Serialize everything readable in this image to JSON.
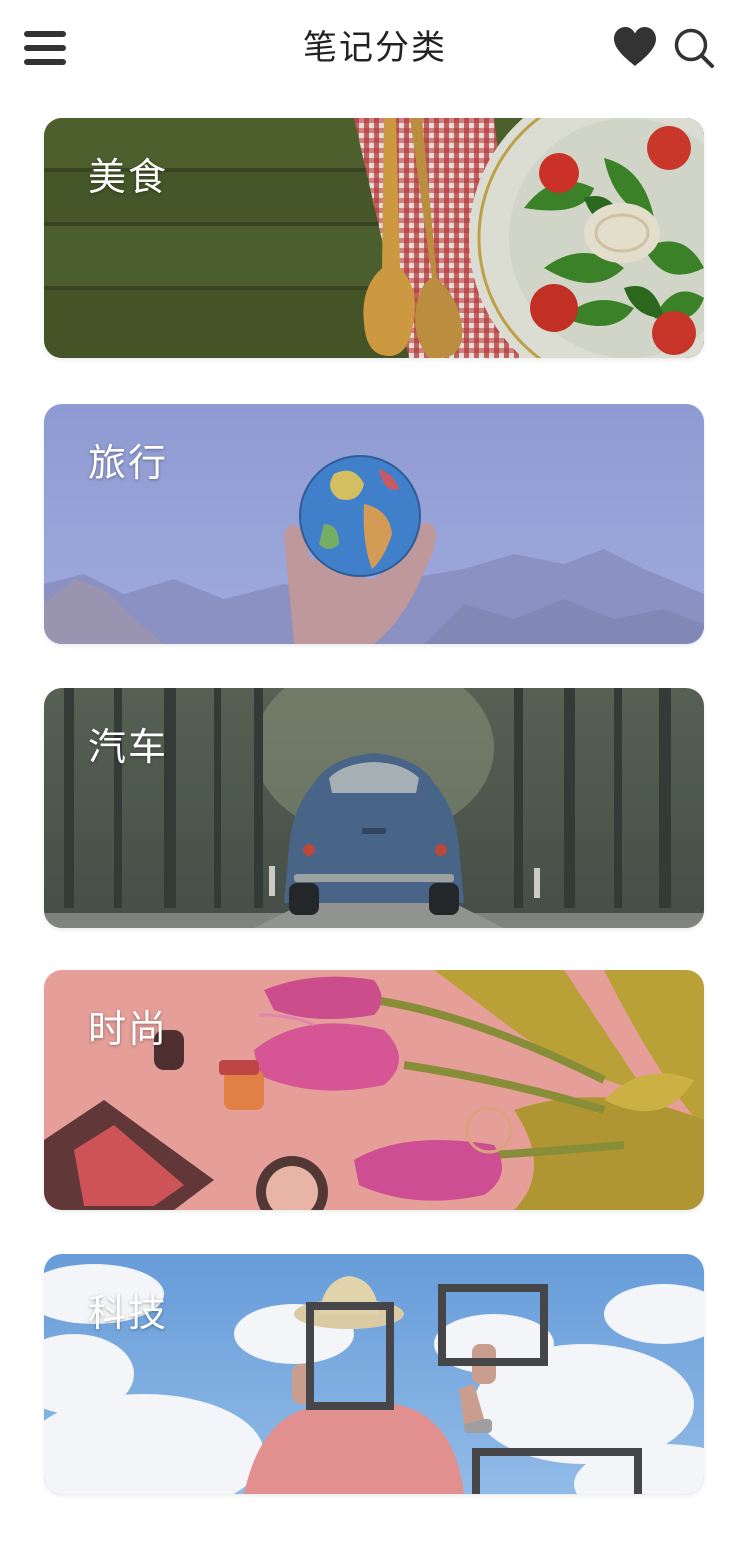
{
  "header": {
    "title": "笔记分类",
    "menu_icon": "hamburger-menu-icon",
    "favorite_icon": "heart-icon",
    "search_icon": "search-icon"
  },
  "categories": [
    {
      "label": "美食",
      "theme": "food",
      "tint": "#4a5a2c"
    },
    {
      "label": "旅行",
      "theme": "travel",
      "tint": "#8d9ad0"
    },
    {
      "label": "汽车",
      "theme": "car",
      "tint": "#4a5550"
    },
    {
      "label": "时尚",
      "theme": "fashion",
      "tint": "#e49b96"
    },
    {
      "label": "科技",
      "theme": "tech",
      "tint": "#6fa2dc"
    }
  ]
}
